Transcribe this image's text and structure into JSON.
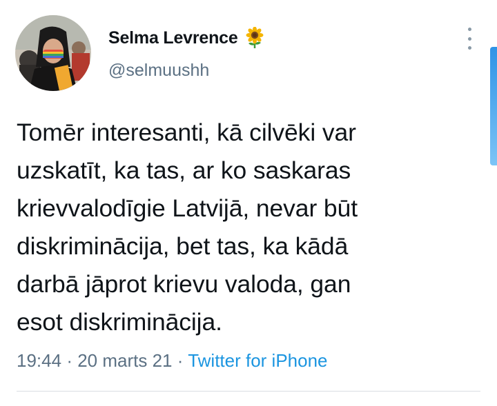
{
  "author": {
    "display_name": "Selma Levrence",
    "handle": "@selmuushh",
    "name_emoji": "sunflower-icon"
  },
  "tweet": {
    "text": "Tomēr interesanti, kā cilvēki var\nuzskatīt, ka tas, ar ko saskaras\nkrievvalodīgie Latvijā, nevar būt\ndiskriminācija, bet tas, ka kādā\ndarbā jāprot krievu valoda, gan\nesot diskriminācija.",
    "time": "19:44",
    "separator": "·",
    "date": "20 marts 21",
    "source": "Twitter for iPhone"
  },
  "colors": {
    "text": "#0f1419",
    "secondary": "#5b7083",
    "link": "#1b95e0",
    "divider": "#d8dde2",
    "scrollbar": "#2f93e6"
  },
  "icons": {
    "more": "more-vertical-icon",
    "avatar": "profile-photo"
  }
}
